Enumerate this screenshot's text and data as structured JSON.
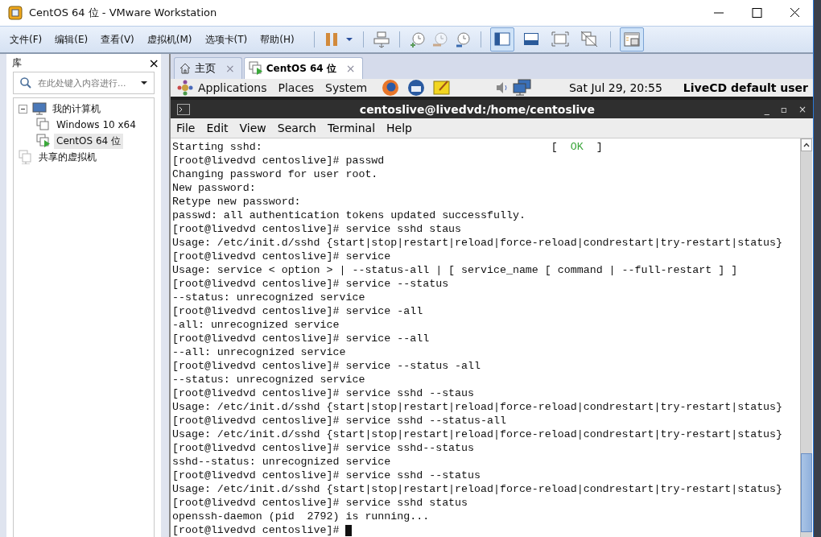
{
  "window": {
    "title": "CentOS 64 位 - VMware Workstation"
  },
  "menu": [
    "文件(F)",
    "编辑(E)",
    "查看(V)",
    "虚拟机(M)",
    "选项卡(T)",
    "帮助(H)"
  ],
  "view_buttons": [
    {
      "selected": true
    },
    {
      "selected": false
    },
    {
      "selected": false
    },
    {
      "selected": false
    }
  ],
  "library_button": {
    "selected": true
  },
  "sidebar": {
    "title": "库",
    "close": "×",
    "search": {
      "placeholder": "在此处键入内容进行..."
    },
    "tree": [
      {
        "label": "我的计算机",
        "kind": "computer",
        "expanded": true,
        "selected": false,
        "children": [
          {
            "label": "Windows 10 x64",
            "kind": "vm",
            "running": false,
            "selected": false
          },
          {
            "label": "CentOS 64 位",
            "kind": "vm",
            "running": true,
            "selected": true
          }
        ]
      },
      {
        "label": "共享的虚拟机",
        "kind": "shared",
        "selected": false
      }
    ]
  },
  "tabs": [
    {
      "label": "主页",
      "kind": "home",
      "selected": false,
      "close": "×"
    },
    {
      "label": "CentOS 64 位",
      "kind": "vm",
      "selected": true,
      "close": "×"
    }
  ],
  "guest_panel": {
    "menus": [
      "Applications",
      "Places",
      "System"
    ],
    "clock": "Sat Jul 29, 20:55",
    "user": "LiveCD default user"
  },
  "terminal": {
    "title": "centoslive@livedvd:/home/centoslive",
    "controls": [
      "_",
      "▫",
      "×"
    ],
    "menu": [
      "File",
      "Edit",
      "View",
      "Search",
      "Terminal",
      "Help"
    ],
    "lines": [
      {
        "text": "Starting sshd:",
        "status": {
          "open": "[",
          "label": "OK",
          "close": "]"
        }
      },
      {
        "text": "[root@livedvd centoslive]# passwd"
      },
      {
        "text": "Changing password for user root."
      },
      {
        "text": "New password:"
      },
      {
        "text": "Retype new password:"
      },
      {
        "text": "passwd: all authentication tokens updated successfully."
      },
      {
        "text": "[root@livedvd centoslive]# service sshd staus"
      },
      {
        "text": "Usage: /etc/init.d/sshd {start|stop|restart|reload|force-reload|condrestart|try-restart|status}"
      },
      {
        "text": "[root@livedvd centoslive]# service"
      },
      {
        "text": "Usage: service < option > | --status-all | [ service_name [ command | --full-restart ] ]"
      },
      {
        "text": "[root@livedvd centoslive]# service --status"
      },
      {
        "text": "--status: unrecognized service"
      },
      {
        "text": "[root@livedvd centoslive]# service -all"
      },
      {
        "text": "-all: unrecognized service"
      },
      {
        "text": "[root@livedvd centoslive]# service --all"
      },
      {
        "text": "--all: unrecognized service"
      },
      {
        "text": "[root@livedvd centoslive]# service --status -all"
      },
      {
        "text": "--status: unrecognized service"
      },
      {
        "text": "[root@livedvd centoslive]# service sshd --staus"
      },
      {
        "text": "Usage: /etc/init.d/sshd {start|stop|restart|reload|force-reload|condrestart|try-restart|status}"
      },
      {
        "text": "[root@livedvd centoslive]# service sshd --status-all"
      },
      {
        "text": "Usage: /etc/init.d/sshd {start|stop|restart|reload|force-reload|condrestart|try-restart|status}"
      },
      {
        "text": "[root@livedvd centoslive]# service sshd--status"
      },
      {
        "text": "sshd--status: unrecognized service"
      },
      {
        "text": "[root@livedvd centoslive]# service sshd --status"
      },
      {
        "text": "Usage: /etc/init.d/sshd {start|stop|restart|reload|force-reload|condrestart|try-restart|status}"
      },
      {
        "text": "[root@livedvd centoslive]# service sshd status"
      },
      {
        "text": "openssh-daemon (pid  2792) is running..."
      },
      {
        "text": "[root@livedvd centoslive]# ",
        "cursor": true
      }
    ]
  }
}
